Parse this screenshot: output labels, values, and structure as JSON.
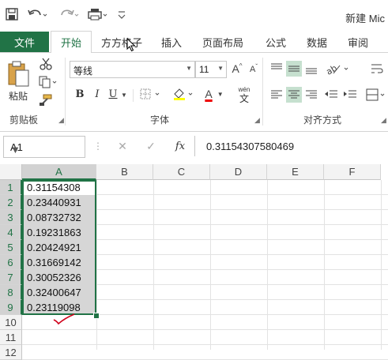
{
  "quick_access": {
    "save_icon": "save-icon",
    "undo_icon": "undo-icon",
    "redo_icon": "redo-icon",
    "customize_icon": "customize-icon",
    "document_title": "新建 Mic"
  },
  "tabs": {
    "file": "文件",
    "home": "开始",
    "fangfang": "方方格子",
    "insert": "插入",
    "page_layout": "页面布局",
    "formulas": "公式",
    "data": "数据",
    "review": "审阅"
  },
  "ribbon": {
    "clipboard": {
      "paste": "粘贴",
      "group_label": "剪贴板"
    },
    "font": {
      "font_name": "等线",
      "font_size": "11",
      "bold": "B",
      "italic": "I",
      "underline": "U",
      "wen": "wén",
      "wen_char": "文",
      "grow": "A",
      "shrink": "A",
      "color_a": "A",
      "group_label": "字体"
    },
    "alignment": {
      "group_label": "对齐方式"
    }
  },
  "formula_bar": {
    "name_box": "A1",
    "fx": "fx",
    "value": "0.31154307580469"
  },
  "sheet": {
    "columns": [
      "A",
      "B",
      "C",
      "D",
      "E",
      "F"
    ],
    "rows": [
      "1",
      "2",
      "3",
      "4",
      "5",
      "6",
      "7",
      "8",
      "9",
      "10",
      "11",
      "12"
    ],
    "column_a_values": [
      "0.31154308",
      "0.23440931",
      "0.08732732",
      "0.19231863",
      "0.20424921",
      "0.31669142",
      "0.30052326",
      "0.32400647",
      "0.23119098"
    ]
  },
  "colors": {
    "excel_green": "#217346",
    "selection_fill": "#d6d6d6",
    "annotation_red": "#d0021b"
  }
}
